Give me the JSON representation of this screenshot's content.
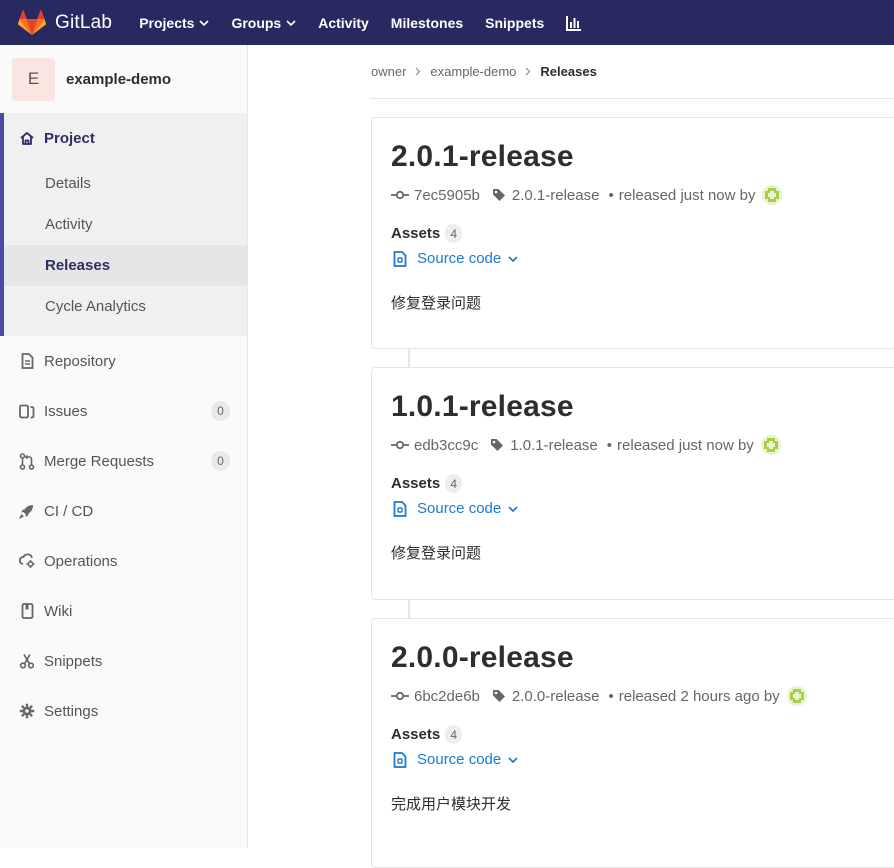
{
  "navbar": {
    "brand": "GitLab",
    "items": [
      {
        "label": "Projects",
        "dropdown": true
      },
      {
        "label": "Groups",
        "dropdown": true
      },
      {
        "label": "Activity",
        "dropdown": false
      },
      {
        "label": "Milestones",
        "dropdown": false
      },
      {
        "label": "Snippets",
        "dropdown": false
      }
    ],
    "chart_icon": "chart-icon",
    "colors": {
      "background": "#292961"
    }
  },
  "sidebar": {
    "project_avatar_letter": "E",
    "project_name": "example-demo",
    "project_section": {
      "label": "Project",
      "icon": "home-icon",
      "items": [
        {
          "label": "Details",
          "active": false
        },
        {
          "label": "Activity",
          "active": false
        },
        {
          "label": "Releases",
          "active": true
        },
        {
          "label": "Cycle Analytics",
          "active": false
        }
      ]
    },
    "items": [
      {
        "label": "Repository",
        "icon": "document-icon"
      },
      {
        "label": "Issues",
        "icon": "issues-icon",
        "badge": "0"
      },
      {
        "label": "Merge Requests",
        "icon": "merge-request-icon",
        "badge": "0"
      },
      {
        "label": "CI / CD",
        "icon": "rocket-icon"
      },
      {
        "label": "Operations",
        "icon": "cloud-gear-icon"
      },
      {
        "label": "Wiki",
        "icon": "book-icon"
      },
      {
        "label": "Snippets",
        "icon": "scissors-icon"
      },
      {
        "label": "Settings",
        "icon": "gear-icon"
      }
    ]
  },
  "breadcrumb": {
    "items": [
      "owner",
      "example-demo"
    ],
    "current": "Releases"
  },
  "releases": [
    {
      "title": "2.0.1-release",
      "commit": "7ec5905b",
      "tag": "2.0.1-release",
      "released": "released just now by",
      "assets_label": "Assets",
      "assets_count": "4",
      "source_label": "Source code",
      "description": "修复登录问题"
    },
    {
      "title": "1.0.1-release",
      "commit": "edb3cc9c",
      "tag": "1.0.1-release",
      "released": "released just now by",
      "assets_label": "Assets",
      "assets_count": "4",
      "source_label": "Source code",
      "description": "修复登录问题"
    },
    {
      "title": "2.0.0-release",
      "commit": "6bc2de6b",
      "tag": "2.0.0-release",
      "released": "released 2 hours ago by",
      "assets_label": "Assets",
      "assets_count": "4",
      "source_label": "Source code",
      "description": "完成用户模块开发"
    }
  ]
}
